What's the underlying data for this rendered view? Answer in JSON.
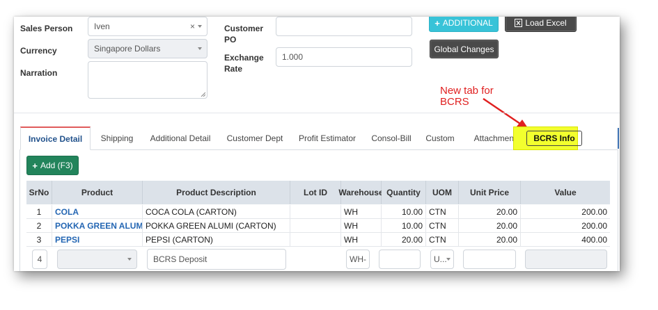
{
  "form": {
    "sales_person_label": "Sales Person",
    "sales_person_value": "Iven",
    "currency_label": "Currency",
    "currency_value": "Singapore Dollars",
    "narration_label": "Narration",
    "customer_po_label_1": "Customer",
    "customer_po_label_2": "PO",
    "exchange_rate_label_1": "Exchange",
    "exchange_rate_label_2": "Rate",
    "exchange_rate_value": "1.000"
  },
  "buttons": {
    "additional": "ADDITIONAL",
    "load_excel": "Load Excel",
    "global_changes": "Global Changes",
    "add": "Add (F3)"
  },
  "annotation": {
    "line1": "New tab for",
    "line2": "BCRS"
  },
  "tabs": [
    "Invoice Detail",
    "Shipping",
    "Additional Detail",
    "Customer Dept",
    "Profit Estimator",
    "Consol-Bill",
    "Custom",
    "Attachment",
    "BCRS Info"
  ],
  "table": {
    "headers": [
      "SrNo",
      "Product",
      "Product Description",
      "Lot ID",
      "Warehouse",
      "Quantity",
      "UOM",
      "Unit Price",
      "Value"
    ],
    "rows": [
      {
        "srno": "1",
        "product": "COLA",
        "description": "COCA COLA (CARTON)",
        "lot": "",
        "warehouse": "WH",
        "quantity": "10.00",
        "uom": "CTN",
        "unit_price": "20.00",
        "value": "200.00"
      },
      {
        "srno": "2",
        "product": "POKKA GREEN ALUMI",
        "description": "POKKA GREEN ALUMI (CARTON)",
        "lot": "",
        "warehouse": "WH",
        "quantity": "10.00",
        "uom": "CTN",
        "unit_price": "20.00",
        "value": "200.00"
      },
      {
        "srno": "3",
        "product": "PEPSI",
        "description": "PEPSI (CARTON)",
        "lot": "",
        "warehouse": "WH",
        "quantity": "20.00",
        "uom": "CTN",
        "unit_price": "20.00",
        "value": "400.00"
      }
    ],
    "edit_row": {
      "srno": "4",
      "description": "BCRS Deposit",
      "warehouse": "WH-",
      "uom": "U..."
    }
  },
  "colors": {
    "accent_link": "#2466b3",
    "active_tab_top": "#e05a5a",
    "highlight": "#f2ff2e",
    "annotation": "#e02020"
  }
}
